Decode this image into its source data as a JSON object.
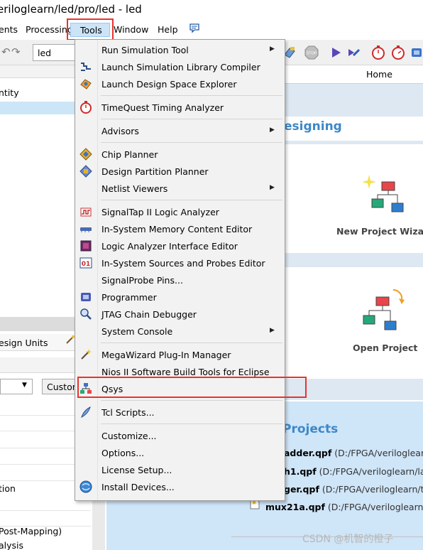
{
  "window": {
    "title": "eriloglearn/led/pro/led - led"
  },
  "menubar": {
    "items": [
      {
        "label": "ents"
      },
      {
        "label": "Processing"
      },
      {
        "label": "Tools"
      },
      {
        "label": "Window"
      },
      {
        "label": "Help"
      }
    ]
  },
  "toolbar": {
    "revision_combo": "led"
  },
  "left_pane": {
    "entity_header": "ntity",
    "design_units_tab": "esign Units",
    "custom_button": "Custom",
    "row_tion": "tion",
    "row_post_mapping": "Post-Mapping)",
    "row_alysis": "alysis"
  },
  "home": {
    "tab_label": "Home",
    "designing_heading": "esigning",
    "new_project_label": "New Project Wizard",
    "open_project_label": "Open Project",
    "recent_heading": "Projects",
    "recent": [
      {
        "name": "adder.qpf",
        "path": "(D:/FPGA/veriloglearn/"
      },
      {
        "name": "h1.qpf",
        "path": "(D:/FPGA/veriloglearn/latch"
      },
      {
        "name": "ger.qpf",
        "path": "(D:/FPGA/veriloglearn/trig"
      },
      {
        "name": "mux21a.qpf",
        "path": "(D:/FPGA/veriloglearn/mu"
      }
    ]
  },
  "tools_menu": {
    "items": [
      {
        "label": "Run Simulation Tool",
        "icon": "none",
        "submenu": true
      },
      {
        "label": "Launch Simulation Library Compiler",
        "icon": "sim-library-icon",
        "submenu": false
      },
      {
        "label": "Launch Design Space Explorer",
        "icon": "design-space-icon",
        "submenu": false
      },
      {
        "label": "TimeQuest Timing Analyzer",
        "icon": "stopwatch-icon",
        "submenu": false
      },
      {
        "label": "Advisors",
        "icon": "none",
        "submenu": true
      },
      {
        "label": "Chip Planner",
        "icon": "chip-planner-icon",
        "submenu": false
      },
      {
        "label": "Design Partition Planner",
        "icon": "partition-planner-icon",
        "submenu": false
      },
      {
        "label": "Netlist Viewers",
        "icon": "none",
        "submenu": true
      },
      {
        "label": "SignalTap II Logic Analyzer",
        "icon": "signaltap-icon",
        "submenu": false
      },
      {
        "label": "In-System Memory Content Editor",
        "icon": "memory-editor-icon",
        "submenu": false
      },
      {
        "label": "Logic Analyzer Interface Editor",
        "icon": "logic-analyzer-icon",
        "submenu": false
      },
      {
        "label": "In-System Sources and Probes Editor",
        "icon": "sources-probes-icon",
        "submenu": false
      },
      {
        "label": "SignalProbe Pins...",
        "icon": "none",
        "submenu": false
      },
      {
        "label": "Programmer",
        "icon": "programmer-icon",
        "submenu": false
      },
      {
        "label": "JTAG Chain Debugger",
        "icon": "jtag-debugger-icon",
        "submenu": false
      },
      {
        "label": "System Console",
        "icon": "none",
        "submenu": true
      },
      {
        "label": "MegaWizard Plug-In Manager",
        "icon": "megawizard-icon",
        "submenu": false
      },
      {
        "label": "Nios II Software Build Tools for Eclipse",
        "icon": "none",
        "submenu": false
      },
      {
        "label": "Qsys",
        "icon": "qsys-icon",
        "submenu": false
      },
      {
        "label": "Tcl Scripts...",
        "icon": "tcl-scripts-icon",
        "submenu": false
      },
      {
        "label": "Customize...",
        "icon": "none",
        "submenu": false
      },
      {
        "label": "Options...",
        "icon": "none",
        "submenu": false
      },
      {
        "label": "License Setup...",
        "icon": "none",
        "submenu": false
      },
      {
        "label": "Install Devices...",
        "icon": "install-devices-icon",
        "submenu": false
      }
    ]
  },
  "watermark": "CSDN @机智的橙子",
  "colors": {
    "highlight_red": "#e8332e",
    "accent_blue": "#3d88c8",
    "menu_bg": "#f2f2f2"
  }
}
